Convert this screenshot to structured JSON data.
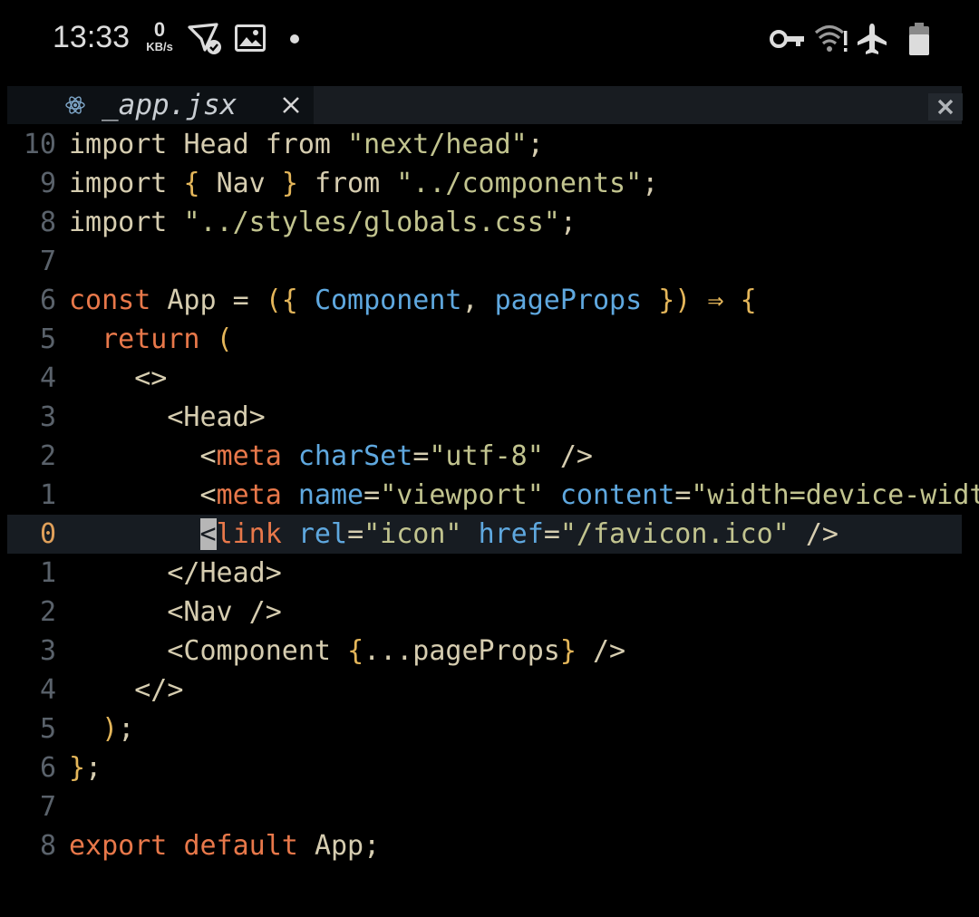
{
  "status": {
    "time": "13:33",
    "speed_value": "0",
    "speed_unit": "KB/s",
    "icons": [
      "send-silent-icon",
      "image-icon",
      "dot-icon",
      "vpn-key-icon",
      "wifi-no-internet-icon",
      "airplane-icon",
      "battery-icon"
    ]
  },
  "tab": {
    "icon": "react-icon",
    "label": "_app.jsx",
    "close_glyph": "×"
  },
  "colors": {
    "background": "#000000",
    "keyword": "#e8784a",
    "string": "#c2c48f",
    "attribute": "#5fa8df",
    "bracket": "#e4b65a",
    "plain": "#d6cdb0",
    "line_number": "#5a626b",
    "current_line_number": "#e0a05a"
  },
  "lines": [
    {
      "n": "10",
      "tokens": [
        {
          "t": "import ",
          "c": "plain"
        },
        {
          "t": "Head ",
          "c": "plain"
        },
        {
          "t": "from ",
          "c": "plain"
        },
        {
          "t": "\"next/head\"",
          "c": "str"
        },
        {
          "t": ";",
          "c": "plain"
        }
      ]
    },
    {
      "n": "9",
      "tokens": [
        {
          "t": "import ",
          "c": "plain"
        },
        {
          "t": "{ ",
          "c": "br"
        },
        {
          "t": "Nav ",
          "c": "plain"
        },
        {
          "t": "} ",
          "c": "br"
        },
        {
          "t": "from ",
          "c": "plain"
        },
        {
          "t": "\"../components\"",
          "c": "str"
        },
        {
          "t": ";",
          "c": "plain"
        }
      ]
    },
    {
      "n": "8",
      "tokens": [
        {
          "t": "import ",
          "c": "plain"
        },
        {
          "t": "\"../styles/globals.css\"",
          "c": "str"
        },
        {
          "t": ";",
          "c": "plain"
        }
      ]
    },
    {
      "n": "7",
      "tokens": []
    },
    {
      "n": "6",
      "tokens": [
        {
          "t": "const ",
          "c": "kw"
        },
        {
          "t": "App ",
          "c": "plain"
        },
        {
          "t": "= ",
          "c": "plain"
        },
        {
          "t": "({ ",
          "c": "br"
        },
        {
          "t": "Component",
          "c": "par"
        },
        {
          "t": ", ",
          "c": "plain"
        },
        {
          "t": "pageProps ",
          "c": "par"
        },
        {
          "t": "}) ",
          "c": "br"
        },
        {
          "t": "⇒ ",
          "c": "br"
        },
        {
          "t": "{",
          "c": "br"
        }
      ]
    },
    {
      "n": "5",
      "tokens": [
        {
          "t": "  ",
          "c": "plain"
        },
        {
          "t": "return ",
          "c": "kw"
        },
        {
          "t": "(",
          "c": "br"
        }
      ]
    },
    {
      "n": "4",
      "tokens": [
        {
          "t": "    ",
          "c": "plain"
        },
        {
          "t": "<>",
          "c": "plain"
        }
      ]
    },
    {
      "n": "3",
      "tokens": [
        {
          "t": "      ",
          "c": "plain"
        },
        {
          "t": "<Head>",
          "c": "plain"
        }
      ]
    },
    {
      "n": "2",
      "tokens": [
        {
          "t": "        ",
          "c": "plain"
        },
        {
          "t": "<",
          "c": "plain"
        },
        {
          "t": "meta ",
          "c": "tag"
        },
        {
          "t": "charSet",
          "c": "attr"
        },
        {
          "t": "=",
          "c": "plain"
        },
        {
          "t": "\"utf-8\" ",
          "c": "str"
        },
        {
          "t": "/>",
          "c": "plain"
        }
      ]
    },
    {
      "n": "1",
      "tokens": [
        {
          "t": "        ",
          "c": "plain"
        },
        {
          "t": "<",
          "c": "plain"
        },
        {
          "t": "meta ",
          "c": "tag"
        },
        {
          "t": "name",
          "c": "attr"
        },
        {
          "t": "=",
          "c": "plain"
        },
        {
          "t": "\"viewport\" ",
          "c": "str"
        },
        {
          "t": "content",
          "c": "attr"
        },
        {
          "t": "=",
          "c": "plain"
        },
        {
          "t": "\"width=device-width,",
          "c": "str"
        }
      ]
    },
    {
      "n": "0",
      "current": true,
      "tokens": [
        {
          "t": "        ",
          "c": "plain"
        },
        {
          "t": "<",
          "c": "cursor"
        },
        {
          "t": "link ",
          "c": "tag"
        },
        {
          "t": "rel",
          "c": "attr"
        },
        {
          "t": "=",
          "c": "plain"
        },
        {
          "t": "\"icon\" ",
          "c": "str"
        },
        {
          "t": "href",
          "c": "attr"
        },
        {
          "t": "=",
          "c": "plain"
        },
        {
          "t": "\"/favicon.ico\" ",
          "c": "str"
        },
        {
          "t": "/>",
          "c": "plain"
        }
      ]
    },
    {
      "n": "1",
      "tokens": [
        {
          "t": "      ",
          "c": "plain"
        },
        {
          "t": "</Head>",
          "c": "plain"
        }
      ]
    },
    {
      "n": "2",
      "tokens": [
        {
          "t": "      ",
          "c": "plain"
        },
        {
          "t": "<Nav />",
          "c": "plain"
        }
      ]
    },
    {
      "n": "3",
      "tokens": [
        {
          "t": "      ",
          "c": "plain"
        },
        {
          "t": "<Component ",
          "c": "plain"
        },
        {
          "t": "{",
          "c": "br"
        },
        {
          "t": "...pageProps",
          "c": "plain"
        },
        {
          "t": "} ",
          "c": "br"
        },
        {
          "t": "/>",
          "c": "plain"
        }
      ]
    },
    {
      "n": "4",
      "tokens": [
        {
          "t": "    ",
          "c": "plain"
        },
        {
          "t": "</>",
          "c": "plain"
        }
      ]
    },
    {
      "n": "5",
      "tokens": [
        {
          "t": "  ",
          "c": "plain"
        },
        {
          "t": ")",
          "c": "br"
        },
        {
          "t": ";",
          "c": "plain"
        }
      ]
    },
    {
      "n": "6",
      "tokens": [
        {
          "t": "}",
          "c": "br"
        },
        {
          "t": ";",
          "c": "plain"
        }
      ]
    },
    {
      "n": "7",
      "tokens": []
    },
    {
      "n": "8",
      "tokens": [
        {
          "t": "export ",
          "c": "kw"
        },
        {
          "t": "default ",
          "c": "kw"
        },
        {
          "t": "App",
          "c": "plain"
        },
        {
          "t": ";",
          "c": "plain"
        }
      ]
    }
  ]
}
